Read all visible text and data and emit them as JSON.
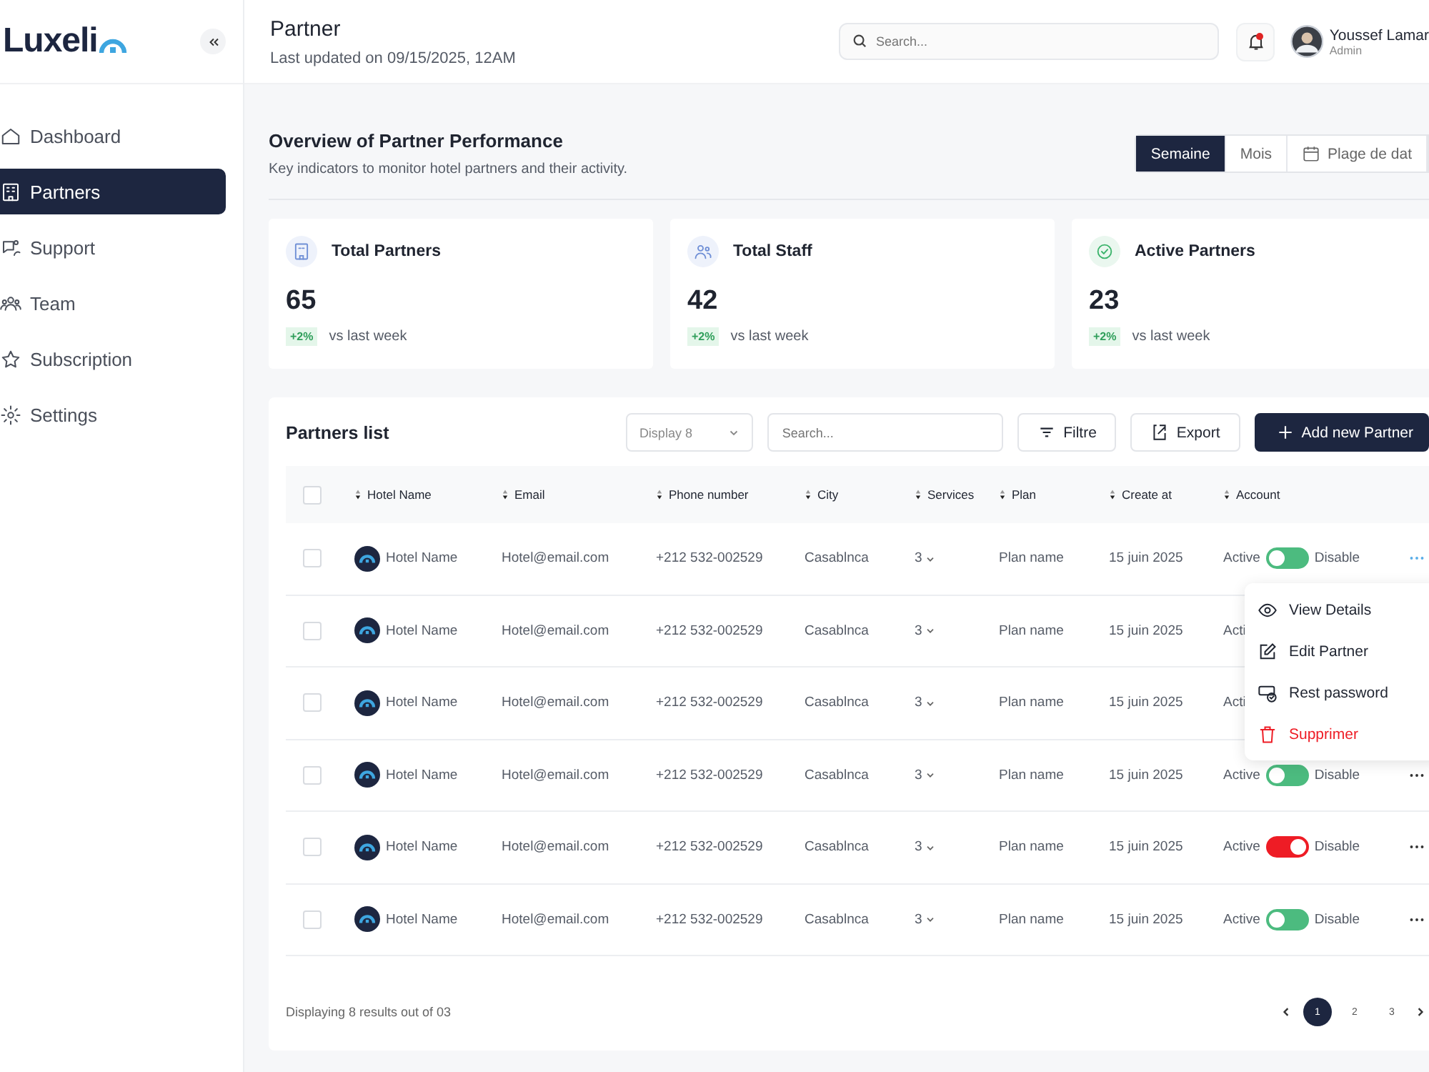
{
  "sidebar": {
    "logo": "Luxeli",
    "items": [
      {
        "label": "Dashboard",
        "selected": false
      },
      {
        "label": "Partners",
        "selected": true
      },
      {
        "label": "Support",
        "selected": false
      },
      {
        "label": "Team",
        "selected": false
      },
      {
        "label": "Subscription",
        "selected": false
      },
      {
        "label": "Settings",
        "selected": false
      }
    ]
  },
  "header": {
    "title": "Partner",
    "subtitle": "Last updated on 09/15/2025, 12AM",
    "search_placeholder": "Search...",
    "notification": true,
    "user": {
      "name": "Youssef Lamar",
      "role": "Admin"
    }
  },
  "overview": {
    "title": "Overview of Partner Performance",
    "subtitle": "Key indicators to monitor hotel partners and their activity.",
    "periods": [
      {
        "label": "Semaine",
        "selected": true,
        "kind": "text"
      },
      {
        "label": "Mois",
        "selected": false,
        "kind": "text"
      },
      {
        "label": "Plage de dat",
        "selected": false,
        "kind": "date"
      }
    ]
  },
  "stats": [
    {
      "label": "Total Partners",
      "value": "65",
      "change": "+2%",
      "note": "vs last week"
    },
    {
      "label": "Total Staff",
      "value": "42",
      "change": "+2%",
      "note": "vs last week"
    },
    {
      "label": "Active Partners",
      "value": "23",
      "change": "+2%",
      "note": "vs last week"
    }
  ],
  "partners_list": {
    "title": "Partners list",
    "display": "Display 8",
    "search_placeholder": "Search...",
    "buttons": [
      {
        "label": "Filtre",
        "kind": "filter"
      },
      {
        "label": "Export",
        "kind": "export"
      },
      {
        "label": "Add new Partner",
        "kind": "add"
      }
    ],
    "select_all_checked": false,
    "columns": [
      "Hotel Name",
      "Email",
      "Phone number",
      "City",
      "Services",
      "Plan",
      "Create at",
      "Account"
    ],
    "rows": [
      {
        "checked": false,
        "hotel": "Hotel Name",
        "email": "Hotel@email.com",
        "phone": "+212 532-002529",
        "city": "Casablnca",
        "services": "3",
        "plan": "Plan name",
        "created": "15 juin 2025",
        "active_label": "Active",
        "toggle": {
          "disabled": false
        },
        "disable_label": "Disable",
        "menu_open": true
      },
      {
        "checked": false,
        "hotel": "Hotel Name",
        "email": "Hotel@email.com",
        "phone": "+212 532-002529",
        "city": "Casablnca",
        "services": "3",
        "plan": "Plan name",
        "created": "15 juin 2025",
        "active_label": "Acti",
        "menu_open": false
      },
      {
        "checked": false,
        "hotel": "Hotel Name",
        "email": "Hotel@email.com",
        "phone": "+212 532-002529",
        "city": "Casablnca",
        "services": "3",
        "plan": "Plan name",
        "created": "15 juin 2025",
        "active_label": "Acti",
        "menu_open": false
      },
      {
        "checked": false,
        "hotel": "Hotel Name",
        "email": "Hotel@email.com",
        "phone": "+212 532-002529",
        "city": "Casablnca",
        "services": "3",
        "plan": "Plan name",
        "created": "15 juin 2025",
        "active_label": "Active",
        "toggle": {
          "disabled": false
        },
        "disable_label": "Disable",
        "menu_open": false
      },
      {
        "checked": false,
        "hotel": "Hotel Name",
        "email": "Hotel@email.com",
        "phone": "+212 532-002529",
        "city": "Casablnca",
        "services": "3",
        "plan": "Plan name",
        "created": "15 juin 2025",
        "active_label": "Active",
        "toggle": {
          "disabled": true
        },
        "disable_label": "Disable",
        "menu_open": false
      },
      {
        "checked": false,
        "hotel": "Hotel Name",
        "email": "Hotel@email.com",
        "phone": "+212 532-002529",
        "city": "Casablnca",
        "services": "3",
        "plan": "Plan name",
        "created": "15 juin 2025",
        "active_label": "Active",
        "toggle": {
          "disabled": false
        },
        "disable_label": "Disable",
        "menu_open": false
      }
    ],
    "footer": "Displaying 8 results out of 03",
    "pages": [
      {
        "label": "1",
        "selected": true
      },
      {
        "label": "2",
        "selected": false
      },
      {
        "label": "3",
        "selected": false
      }
    ]
  },
  "row_menu": {
    "items": [
      {
        "label": "View Details",
        "kind": "view"
      },
      {
        "label": "Edit Partner",
        "kind": "edit"
      },
      {
        "label": "Rest password",
        "kind": "password"
      },
      {
        "label": "Supprimer",
        "kind": "delete"
      }
    ]
  }
}
